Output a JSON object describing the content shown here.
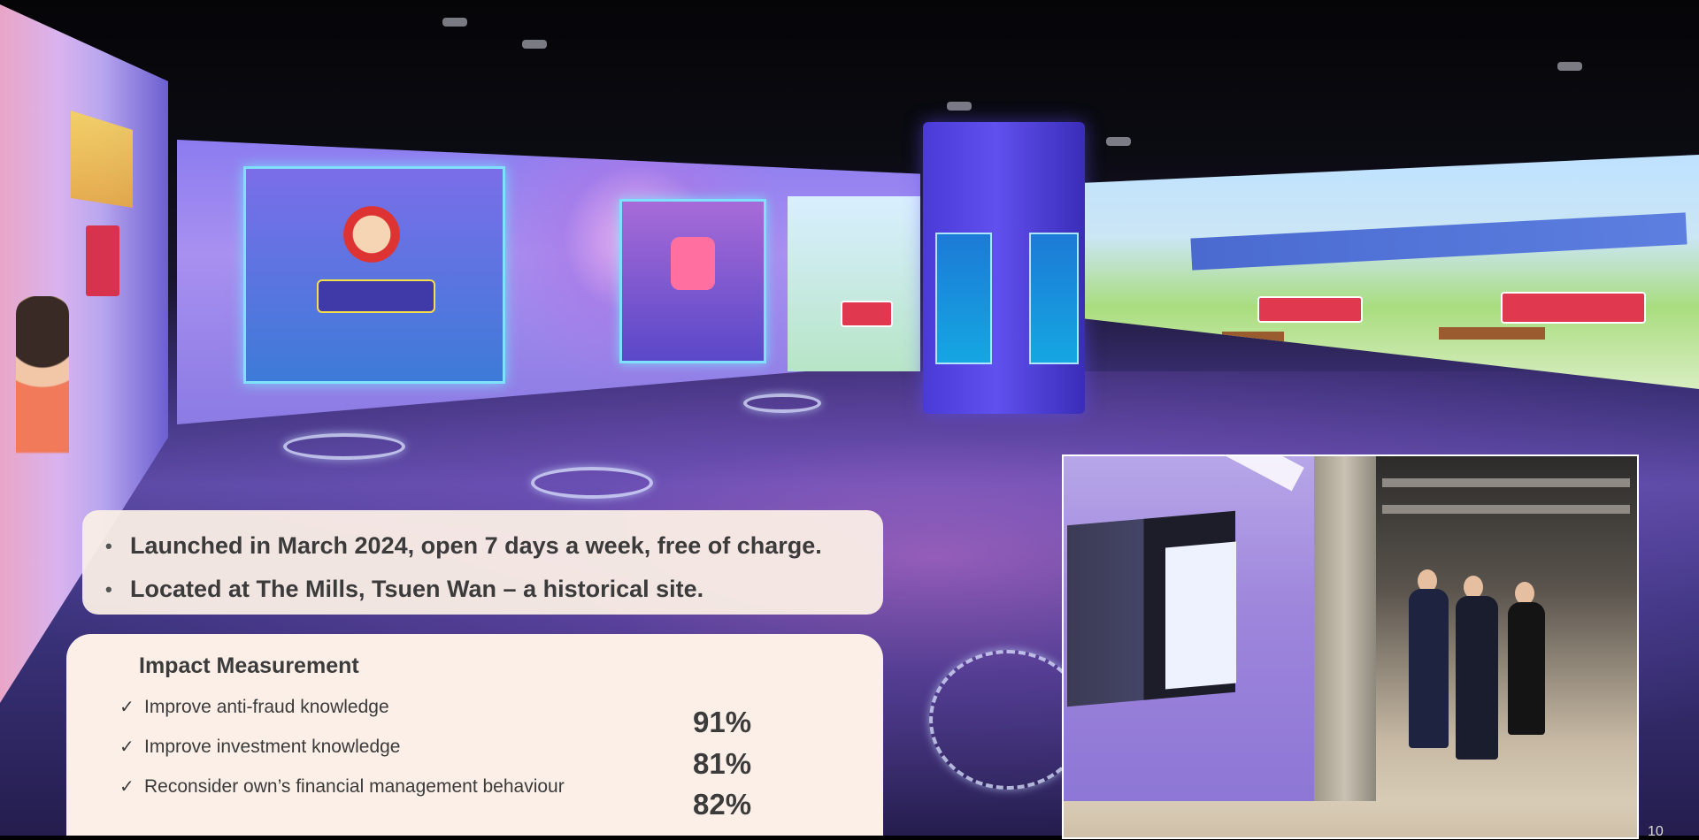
{
  "bullets": [
    {
      "marker": "•",
      "text": "Launched in March 2024, open 7 days a week, free of charge."
    },
    {
      "marker": "•",
      "text": "Located at The Mills, Tsuen Wan – a historical site."
    }
  ],
  "impact": {
    "heading": "Impact Measurement",
    "items": [
      {
        "check": "✓",
        "label": "Improve anti-fraud knowledge",
        "value": "91%"
      },
      {
        "check": "✓",
        "label": "Improve investment knowledge",
        "value": "81%"
      },
      {
        "check": "✓",
        "label": "Reconsider own’s financial management behaviour",
        "value": "82%"
      }
    ]
  },
  "page_number": "10",
  "colors": {
    "box_background": "#fbefe7",
    "text": "#3b3b3b",
    "projection_purple": "#8c7cf0",
    "tower_blue": "#4a3ad6"
  }
}
